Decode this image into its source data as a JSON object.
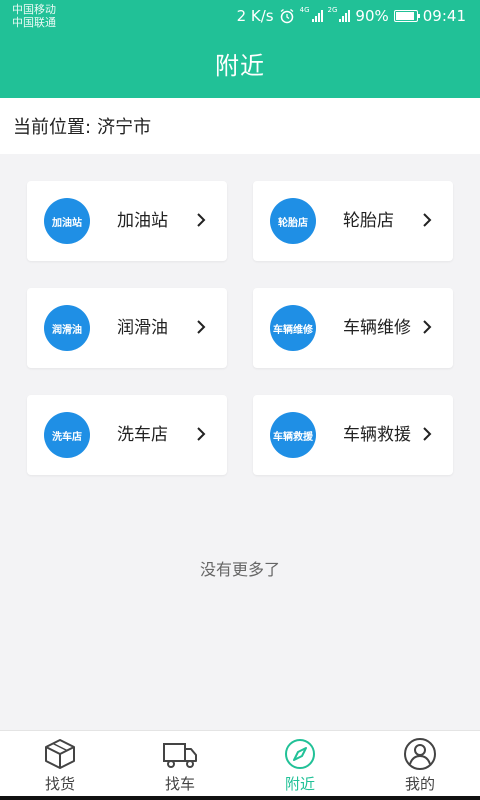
{
  "status_bar": {
    "carrier_1": "中国移动",
    "carrier_2": "中国联通",
    "speed": "2 K/s",
    "net_1": "4G",
    "net_2": "2G",
    "battery": "90%",
    "battery_level": 0.9,
    "time": "09:41"
  },
  "header": {
    "title": "附近"
  },
  "location": {
    "label": "当前位置:",
    "city": "济宁市"
  },
  "categories": [
    {
      "badge": "加油站",
      "label": "加油站"
    },
    {
      "badge": "轮胎店",
      "label": "轮胎店"
    },
    {
      "badge": "润滑油",
      "label": "润滑油"
    },
    {
      "badge": "车辆维修",
      "label": "车辆维修"
    },
    {
      "badge": "洗车店",
      "label": "洗车店"
    },
    {
      "badge": "车辆救援",
      "label": "车辆救援"
    }
  ],
  "footer_text": "没有更多了",
  "tabs": [
    {
      "label": "找货",
      "icon": "box-icon"
    },
    {
      "label": "找车",
      "icon": "truck-icon"
    },
    {
      "label": "附近",
      "icon": "compass-icon",
      "active": true
    },
    {
      "label": "我的",
      "icon": "user-icon"
    }
  ],
  "colors": {
    "accent": "#21c197",
    "badge": "#1f8fe5",
    "background": "#f3f3f5"
  }
}
